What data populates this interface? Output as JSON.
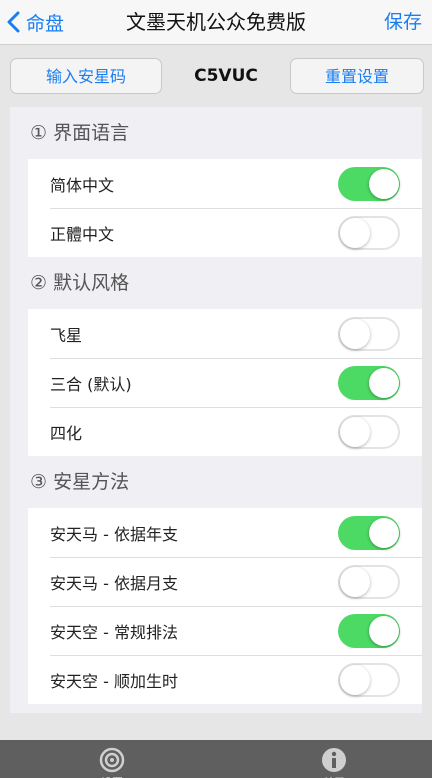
{
  "navbar": {
    "back_label": "命盘",
    "title": "文墨天机公众免费版",
    "save_label": "保存"
  },
  "toolbar": {
    "left_button": "输入安星码",
    "code": "C5VUC",
    "right_button": "重置设置"
  },
  "sections": [
    {
      "header": "① 界面语言",
      "rows": [
        {
          "label": "简体中文",
          "on": true
        },
        {
          "label": "正體中文",
          "on": false
        }
      ]
    },
    {
      "header": "② 默认风格",
      "rows": [
        {
          "label": "飞星",
          "on": false
        },
        {
          "label": "三合 (默认)",
          "on": true
        },
        {
          "label": "四化",
          "on": false
        }
      ]
    },
    {
      "header": "③ 安星方法",
      "rows": [
        {
          "label": "安天马 - 依据年支",
          "on": true
        },
        {
          "label": "安天马 - 依据月支",
          "on": false
        },
        {
          "label": "安天空 - 常规排法",
          "on": true
        },
        {
          "label": "安天空 - 顺加生时",
          "on": false
        }
      ]
    }
  ],
  "tabbar": {
    "tabs": [
      {
        "icon": "target-icon",
        "label": "设置"
      },
      {
        "icon": "info-icon",
        "label": "关于"
      }
    ]
  },
  "colors": {
    "accent": "#1a7ef0",
    "switch_on": "#4cd964",
    "tabbar_bg": "#5f5f5f"
  }
}
